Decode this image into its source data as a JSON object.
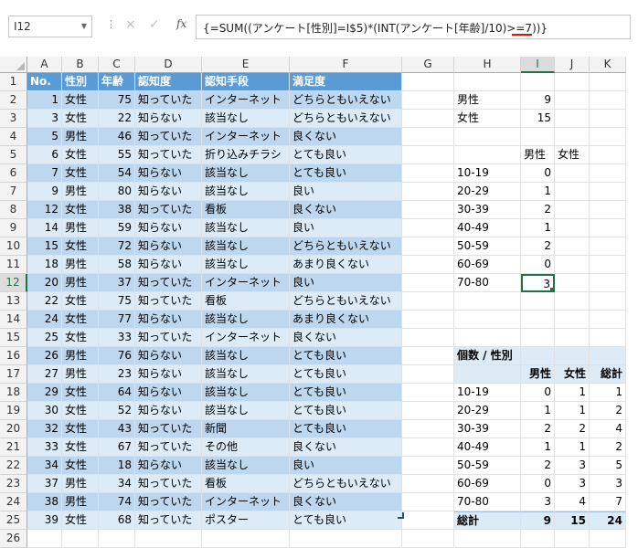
{
  "formula_bar": {
    "name_box": "I12",
    "cancel_glyph": "×",
    "enter_glyph": "✓",
    "fx_label": "fx",
    "formula": "{=SUM((アンケート[性別]=I$5)*(INT(アンケート[年齢]/10)>=7))}"
  },
  "columns": [
    "A",
    "B",
    "C",
    "D",
    "E",
    "F",
    "G",
    "H",
    "I",
    "J",
    "K"
  ],
  "selected_column": "I",
  "selected_row": 12,
  "rows": [
    "1",
    "2",
    "3",
    "4",
    "5",
    "6",
    "7",
    "8",
    "9",
    "10",
    "11",
    "12",
    "13",
    "14",
    "15",
    "16",
    "17",
    "18",
    "19",
    "20",
    "21",
    "22",
    "23",
    "24",
    "25",
    "26"
  ],
  "table": {
    "headers": [
      "No.",
      "性別",
      "年齢",
      "認知度",
      "認知手段",
      "満足度"
    ],
    "rows": [
      [
        "1",
        "女性",
        "75",
        "知っていた",
        "インターネット",
        "どちらともいえない"
      ],
      [
        "3",
        "女性",
        "22",
        "知らない",
        "該当なし",
        "どちらともいえない"
      ],
      [
        "5",
        "男性",
        "46",
        "知っていた",
        "インターネット",
        "良くない"
      ],
      [
        "6",
        "女性",
        "55",
        "知っていた",
        "折り込みチラシ",
        "とても良い"
      ],
      [
        "7",
        "女性",
        "54",
        "知らない",
        "該当なし",
        "とても良い"
      ],
      [
        "9",
        "男性",
        "80",
        "知らない",
        "該当なし",
        "良い"
      ],
      [
        "12",
        "女性",
        "38",
        "知っていた",
        "看板",
        "良くない"
      ],
      [
        "14",
        "男性",
        "59",
        "知らない",
        "該当なし",
        "良い"
      ],
      [
        "15",
        "女性",
        "72",
        "知らない",
        "該当なし",
        "どちらともいえない"
      ],
      [
        "18",
        "男性",
        "58",
        "知らない",
        "該当なし",
        "あまり良くない"
      ],
      [
        "20",
        "男性",
        "37",
        "知っていた",
        "インターネット",
        "良い"
      ],
      [
        "22",
        "女性",
        "75",
        "知っていた",
        "看板",
        "どちらともいえない"
      ],
      [
        "24",
        "女性",
        "77",
        "知らない",
        "該当なし",
        "あまり良くない"
      ],
      [
        "25",
        "女性",
        "33",
        "知っていた",
        "インターネット",
        "良くない"
      ],
      [
        "26",
        "男性",
        "76",
        "知らない",
        "該当なし",
        "とても良い"
      ],
      [
        "27",
        "男性",
        "23",
        "知らない",
        "該当なし",
        "とても良い"
      ],
      [
        "29",
        "女性",
        "64",
        "知らない",
        "該当なし",
        "とても良い"
      ],
      [
        "30",
        "女性",
        "52",
        "知らない",
        "該当なし",
        "とても良い"
      ],
      [
        "32",
        "女性",
        "43",
        "知っていた",
        "新聞",
        "とても良い"
      ],
      [
        "33",
        "女性",
        "67",
        "知っていた",
        "その他",
        "良くない"
      ],
      [
        "34",
        "女性",
        "18",
        "知らない",
        "該当なし",
        "良い"
      ],
      [
        "37",
        "男性",
        "34",
        "知っていた",
        "看板",
        "どちらともいえない"
      ],
      [
        "38",
        "男性",
        "74",
        "知っていた",
        "インターネット",
        "良くない"
      ],
      [
        "39",
        "女性",
        "68",
        "知っていた",
        "ポスター",
        "とても良い"
      ]
    ]
  },
  "summary": {
    "gender_counts": [
      [
        "男性",
        "9"
      ],
      [
        "女性",
        "15"
      ]
    ],
    "col_headers": [
      "男性",
      "女性"
    ],
    "age_rows": [
      [
        "10-19",
        "0"
      ],
      [
        "20-29",
        "1"
      ],
      [
        "30-39",
        "2"
      ],
      [
        "40-49",
        "1"
      ],
      [
        "50-59",
        "2"
      ],
      [
        "60-69",
        "0"
      ],
      [
        "70-80",
        "3"
      ]
    ]
  },
  "pivot": {
    "title": "個数 / 性別",
    "headers": [
      "男性",
      "女性",
      "総計"
    ],
    "rows": [
      [
        "10-19",
        "0",
        "1",
        "1"
      ],
      [
        "20-29",
        "1",
        "1",
        "2"
      ],
      [
        "30-39",
        "2",
        "2",
        "4"
      ],
      [
        "40-49",
        "1",
        "1",
        "2"
      ],
      [
        "50-59",
        "2",
        "3",
        "5"
      ],
      [
        "60-69",
        "0",
        "3",
        "3"
      ],
      [
        "70-80",
        "3",
        "4",
        "7"
      ]
    ],
    "total": [
      "総計",
      "9",
      "15",
      "24"
    ]
  },
  "colors": {
    "header_blue": "#5b9bd5",
    "band_dark": "#bdd7ee",
    "band_light": "#ddebf7",
    "excel_green": "#217346"
  }
}
